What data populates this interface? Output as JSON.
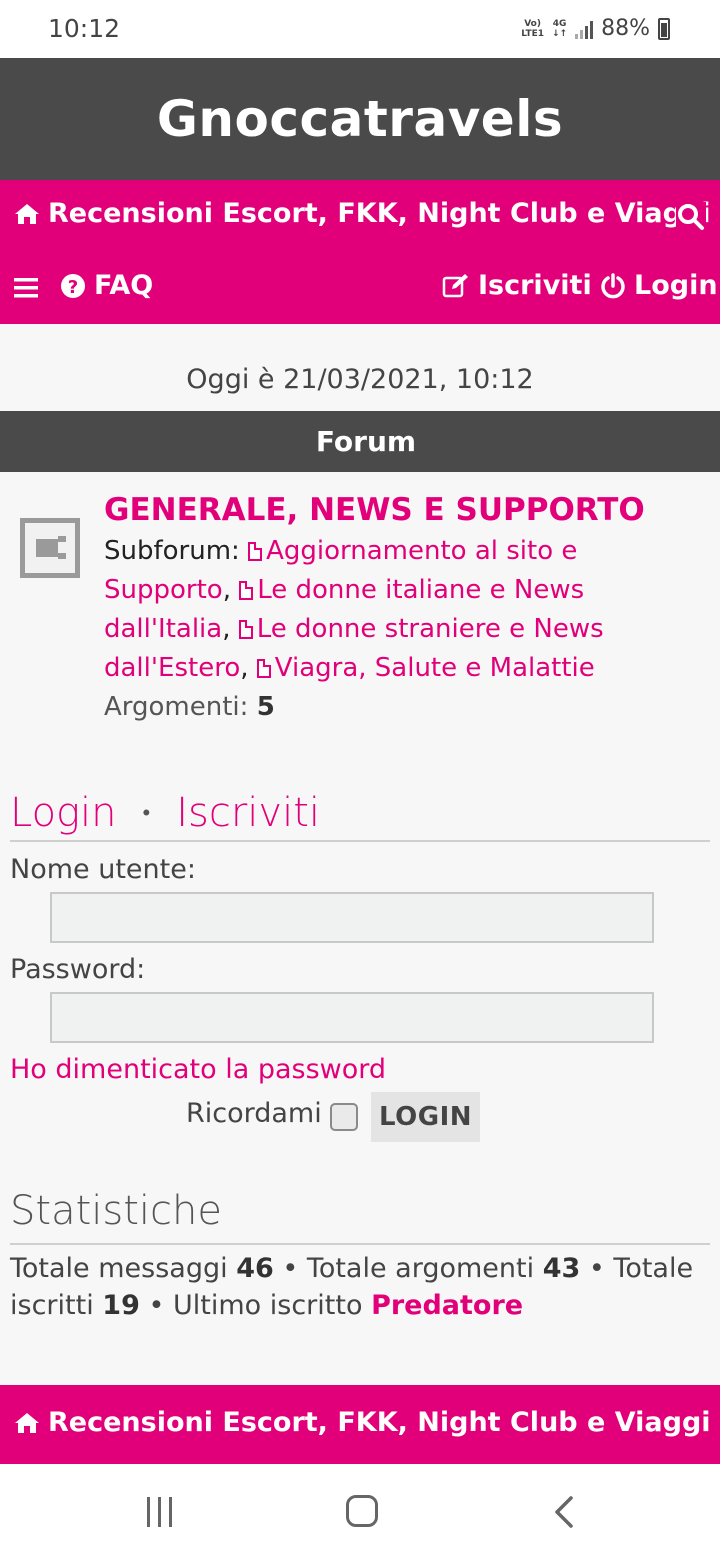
{
  "status": {
    "time": "10:12",
    "volte_top": "Vo)",
    "volte_bottom": "LTE1",
    "net": "4G",
    "net_arrows": "↓↑",
    "battery": "88%"
  },
  "site": {
    "title": "Gnoccatravels"
  },
  "breadcrumb": {
    "label": "Recensioni Escort, FKK, Night Club e Viaggi della"
  },
  "nav": {
    "faq": "FAQ",
    "register": "Iscriviti",
    "login": "Login"
  },
  "date": "Oggi è 21/03/2021, 10:12",
  "forum_header": "Forum",
  "forum": {
    "title": "GENERALE, NEWS E SUPPORTO",
    "subforum_label": "Subforum:",
    "subforums": [
      "Aggiornamento al sito e Supporto",
      "Le donne italiane e News dall'Italia",
      "Le donne straniere e News dall'Estero",
      "Viagra, Salute e Malattie"
    ],
    "sep": ",",
    "topics_label": "Argomenti:",
    "topics_count": "5"
  },
  "login_box": {
    "login_link": "Login",
    "dot": "•",
    "register_link": "Iscriviti",
    "username_label": "Nome utente:",
    "username_value": "",
    "password_label": "Password:",
    "password_value": "",
    "forgot": "Ho dimenticato la password",
    "remember": "Ricordami",
    "remember_checked": false,
    "submit": "LOGIN"
  },
  "stats": {
    "heading": "Statistiche",
    "posts_label": "Totale messaggi",
    "posts": "46",
    "topics_label": "Totale argomenti",
    "topics": "43",
    "users_label": "Totale iscritti",
    "users": "19",
    "newest_label": "Ultimo iscritto",
    "newest": "Predatore",
    "sep": "•"
  },
  "colors": {
    "accent": "#e2007a",
    "header": "#4a4a4a",
    "background": "#f7f7f7"
  },
  "icons": {
    "home": "home-icon",
    "search": "search-icon",
    "menu": "menu-icon",
    "faq": "question-circle-icon",
    "register": "edit-icon",
    "login": "power-icon",
    "forum": "forum-read-icon",
    "subforum": "document-icon"
  }
}
